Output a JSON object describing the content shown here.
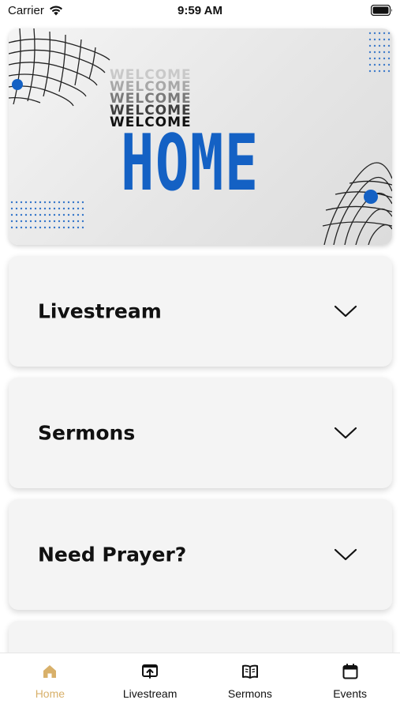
{
  "status_bar": {
    "carrier": "Carrier",
    "time": "9:59 AM"
  },
  "hero": {
    "welcome_lines": [
      "WELCOME",
      "WELCOME",
      "WELCOME",
      "WELCOME",
      "WELCOME"
    ],
    "title": "HOME",
    "accent_color": "#1461c4"
  },
  "sections": [
    {
      "label": "Livestream"
    },
    {
      "label": "Sermons"
    },
    {
      "label": "Need Prayer?"
    },
    {
      "label": ""
    }
  ],
  "tab_bar": {
    "active_color": "#d8b06a",
    "tabs": [
      {
        "label": "Home",
        "icon": "home-icon",
        "active": true
      },
      {
        "label": "Livestream",
        "icon": "livestream-icon",
        "active": false
      },
      {
        "label": "Sermons",
        "icon": "book-icon",
        "active": false
      },
      {
        "label": "Events",
        "icon": "calendar-icon",
        "active": false
      }
    ]
  }
}
